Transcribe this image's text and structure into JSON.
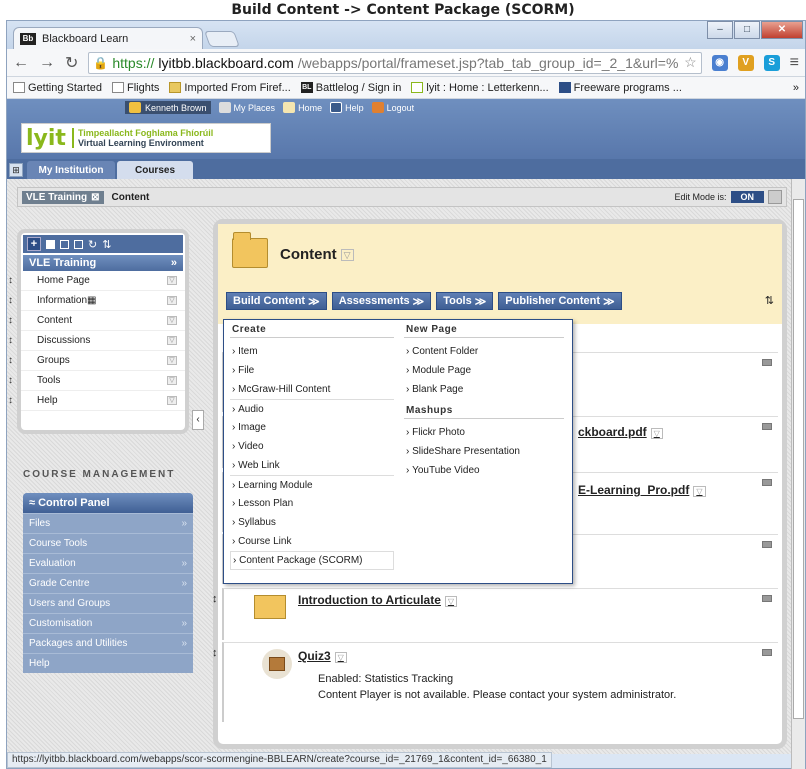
{
  "caption": "Build Content -> Content Package (SCORM)",
  "browser": {
    "tab_title": "Blackboard Learn",
    "tab_favicon": "Bb",
    "url_https": "https://",
    "url_host": "lyitbb.blackboard.com",
    "url_rest": "/webapps/portal/frameset.jsp?tab_tab_group_id=_2_1&url=%",
    "bookmarks": [
      {
        "label": "Getting Started",
        "icon": "page-icon"
      },
      {
        "label": "Flights",
        "icon": "page-icon"
      },
      {
        "label": "Imported From Firef...",
        "icon": "folder-icon"
      },
      {
        "label": "Battlelog / Sign in",
        "icon": "battlelog-icon"
      },
      {
        "label": "lyit : Home : Letterkenn...",
        "icon": "lyit-icon"
      },
      {
        "label": "Freeware programs ...",
        "icon": "freeware-icon"
      }
    ],
    "status_url": "https://lyitbb.blackboard.com/webapps/scor-scormengine-BBLEARN/create?course_id=_21769_1&content_id=_66380_1"
  },
  "header": {
    "logo_text": "lyit",
    "logo_line1": "Timpeallacht Foghlama Fhíorúil",
    "logo_line2": "Virtual Learning Environment",
    "user": "Kenneth Brown",
    "nav": [
      "My Places",
      "Home",
      "Help",
      "Logout"
    ]
  },
  "course_tabs": [
    "My Institution",
    "Courses"
  ],
  "breadcrumb": {
    "course": "VLE Training",
    "current": "Content",
    "edit_mode_label": "Edit Mode is:",
    "edit_mode_value": "ON"
  },
  "course_menu": {
    "title": "VLE Training",
    "items": [
      "Home Page",
      "Information",
      "Content",
      "Discussions",
      "Groups",
      "Tools",
      "Help"
    ]
  },
  "course_management": {
    "heading": "COURSE MANAGEMENT",
    "panel_title": "Control Panel",
    "items": [
      "Files",
      "Course Tools",
      "Evaluation",
      "Grade Centre",
      "Users and Groups",
      "Customisation",
      "Packages and Utilities",
      "Help"
    ]
  },
  "content": {
    "title": "Content",
    "actions": [
      "Build Content",
      "Assessments",
      "Tools",
      "Publisher Content"
    ],
    "items": [
      {
        "title": "ckboard.pdf"
      },
      {
        "title": "E-Learning_Pro.pdf"
      },
      {
        "title": "Introduction to Articulate"
      },
      {
        "title": "Quiz3",
        "desc1": "Enabled:  Statistics Tracking",
        "desc2": "Content Player is not available. Please contact your system administrator."
      }
    ]
  },
  "dropdown": {
    "create_header": "Create",
    "create_items": [
      "Item",
      "File",
      "McGraw-Hill Content",
      "Audio",
      "Image",
      "Video",
      "Web Link",
      "Learning Module",
      "Lesson Plan",
      "Syllabus",
      "Course Link",
      "Content Package (SCORM)"
    ],
    "newpage_header": "New Page",
    "newpage_items": [
      "Content Folder",
      "Module Page",
      "Blank Page"
    ],
    "mashups_header": "Mashups",
    "mashups_items": [
      "Flickr Photo",
      "SlideShare Presentation",
      "YouTube Video"
    ]
  }
}
